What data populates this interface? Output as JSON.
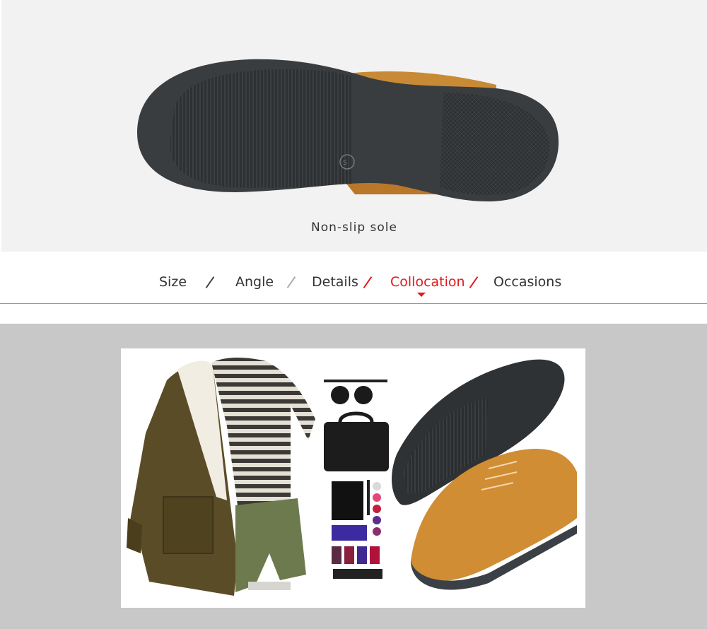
{
  "hero": {
    "caption": "Non-slip sole"
  },
  "nav": {
    "items": [
      {
        "label": "Size",
        "active": false
      },
      {
        "label": "Angle",
        "active": false
      },
      {
        "label": "Details",
        "active": false
      },
      {
        "label": "Collocation",
        "active": true
      },
      {
        "label": "Occasions",
        "active": false
      }
    ]
  },
  "colors": {
    "accent": "#e2191b",
    "hero_bg": "#f2f2f2",
    "band_bg": "#c8c8c8"
  }
}
